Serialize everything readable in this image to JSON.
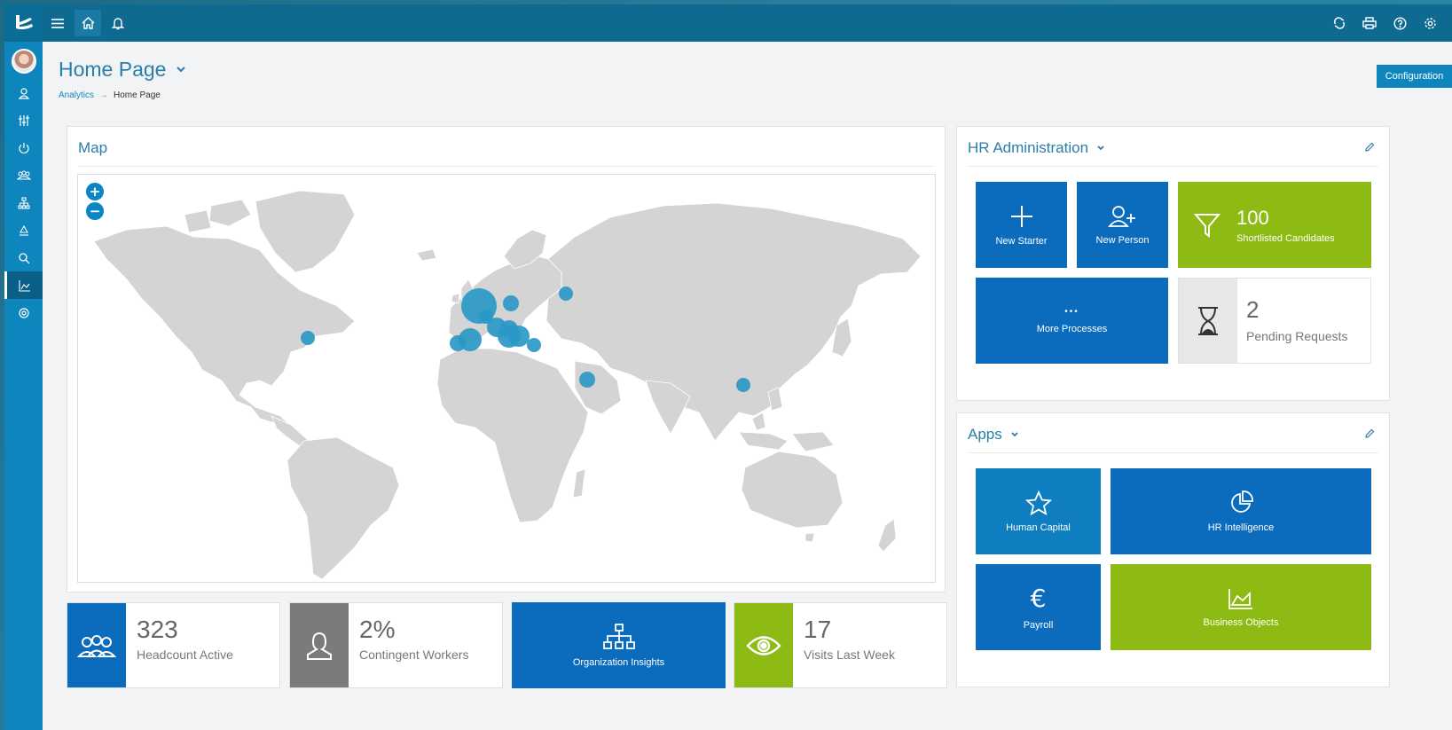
{
  "app": {
    "accent": "#0e86bd",
    "topbar_color": "#0f6a92",
    "green": "#8dbb14"
  },
  "rail": {
    "items": [
      "person-icon",
      "sliders-icon",
      "power-icon",
      "team-icon",
      "org-icon",
      "recycle-icon",
      "search-icon",
      "chart-icon",
      "settings-icon"
    ]
  },
  "header": {
    "title": "Home Page",
    "breadcrumb": {
      "parent": "Analytics",
      "current": "Home Page"
    },
    "config_button": "Configuration"
  },
  "map_panel": {
    "title": "Map",
    "zoom_in": "+",
    "zoom_out": "−"
  },
  "hr_admin": {
    "title": "HR Administration",
    "new_starter": "New Starter",
    "new_person": "New Person",
    "shortlisted_count": "100",
    "shortlisted_label": "Shortlisted Candidates",
    "more_label": "More Processes",
    "more_dots": "•••",
    "pending_count": "2",
    "pending_label": "Pending Requests"
  },
  "apps": {
    "title": "Apps",
    "human_capital": "Human Capital",
    "hr_intelligence": "HR Intelligence",
    "payroll": "Payroll",
    "business_objects": "Business Objects"
  },
  "stats": {
    "headcount_value": "323",
    "headcount_label": "Headcount Active",
    "contingent_value": "2%",
    "contingent_label": "Contingent Workers",
    "org_insights": "Organization Insights",
    "visits_value": "17",
    "visits_label": "Visits Last Week"
  }
}
